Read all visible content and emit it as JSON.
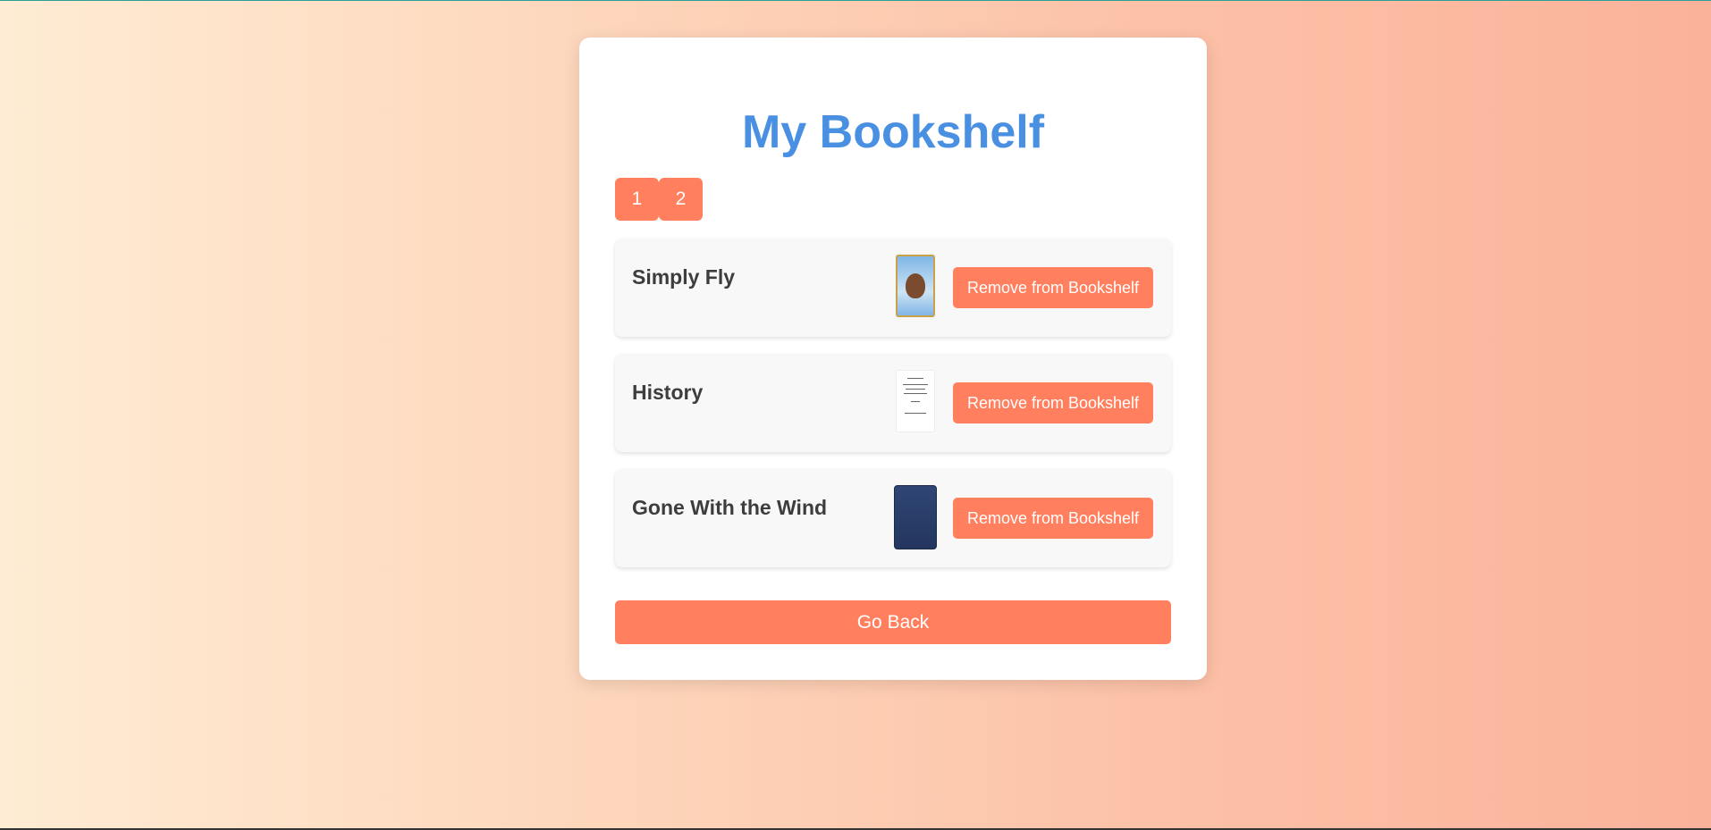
{
  "page": {
    "title": "My Bookshelf"
  },
  "pagination": {
    "pages": [
      "1",
      "2"
    ]
  },
  "books": [
    {
      "title": "Simply Fly",
      "remove_label": "Remove from Bookshelf"
    },
    {
      "title": "History",
      "remove_label": "Remove from Bookshelf"
    },
    {
      "title": "Gone With the Wind",
      "remove_label": "Remove from Bookshelf"
    }
  ],
  "actions": {
    "go_back_label": "Go Back"
  },
  "colors": {
    "accent": "#ff7f5e",
    "title": "#4a90e2"
  }
}
